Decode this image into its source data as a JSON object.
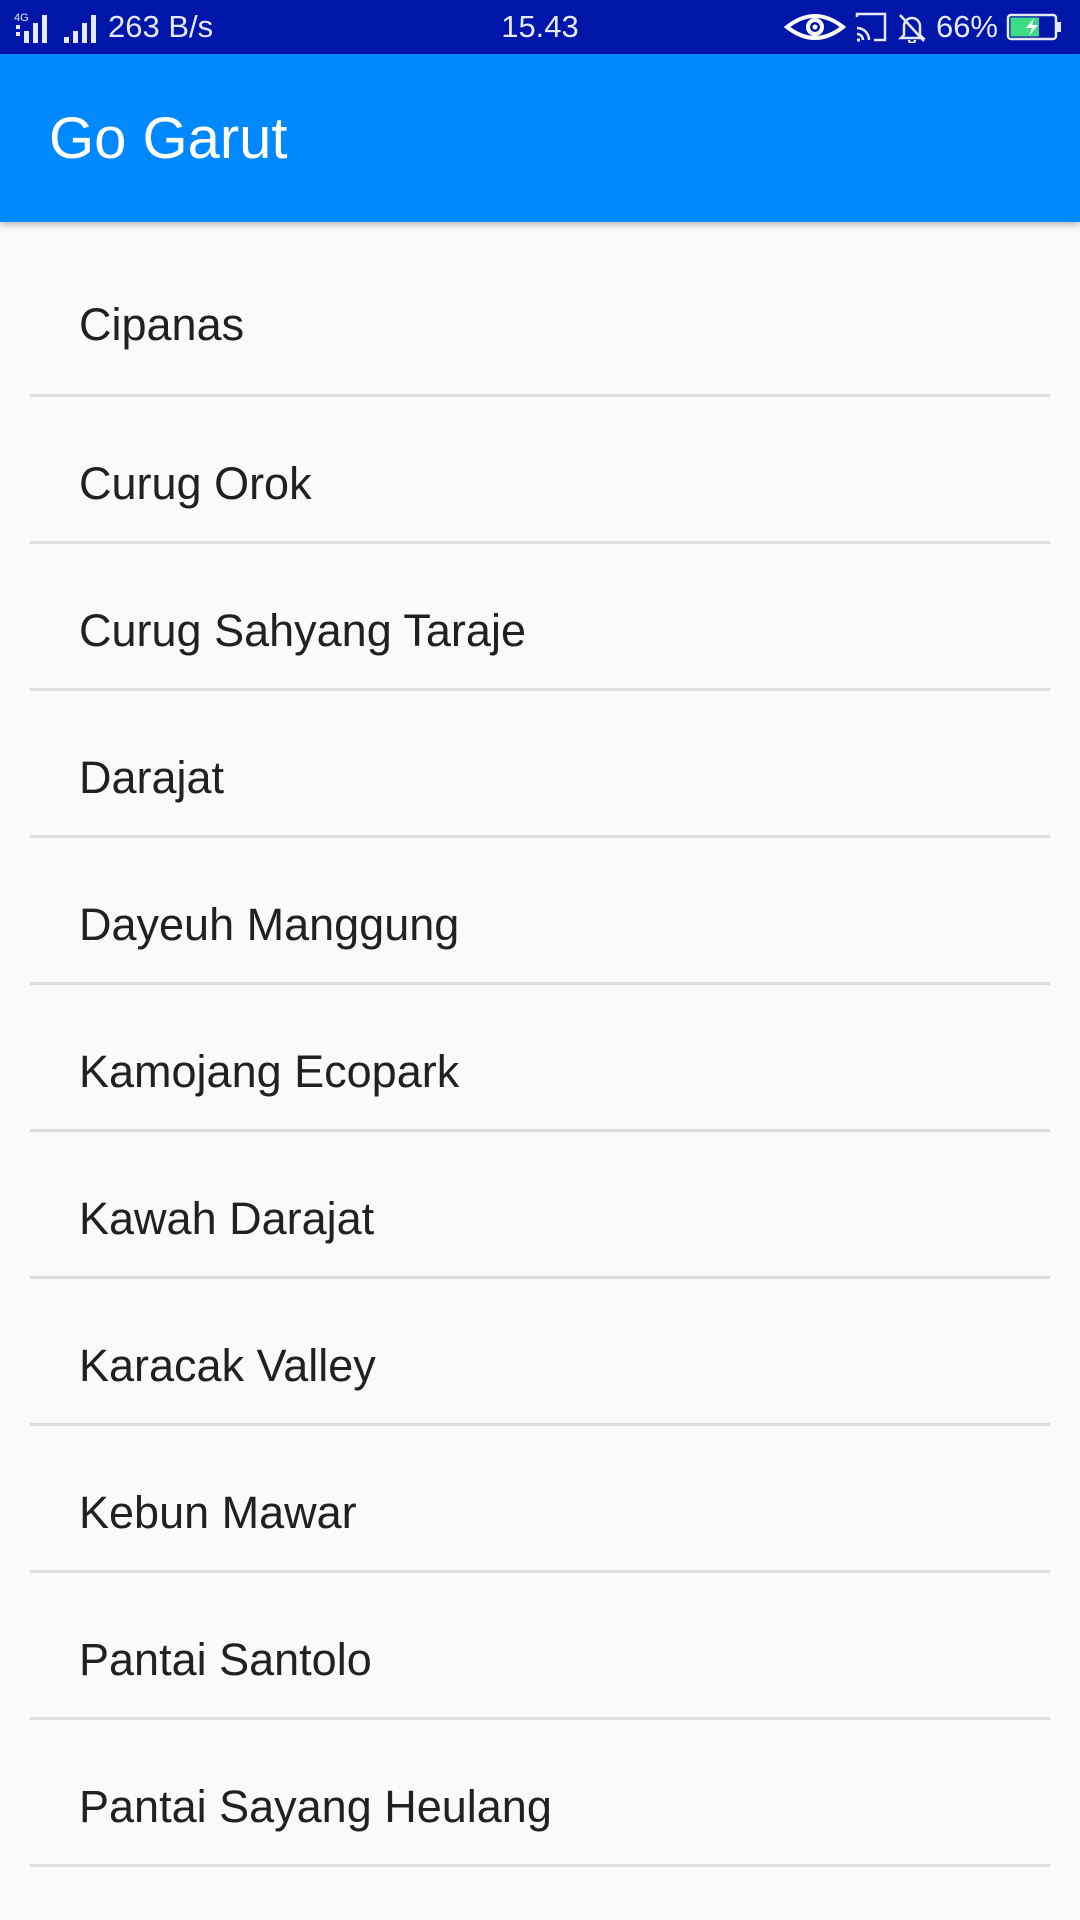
{
  "status_bar": {
    "network_type": "4G",
    "data_speed": "263 B/s",
    "time": "15.43",
    "battery_percent": "66%",
    "battery_level": 0.66,
    "icons": [
      "signal-4g-icon",
      "signal-icon",
      "eye-icon",
      "cast-icon",
      "bell-off-icon",
      "battery-charging-icon"
    ]
  },
  "app_bar": {
    "title": "Go Garut"
  },
  "list": {
    "items": [
      {
        "label": "Cipanas"
      },
      {
        "label": "Curug Orok"
      },
      {
        "label": "Curug Sahyang Taraje"
      },
      {
        "label": "Darajat"
      },
      {
        "label": "Dayeuh Manggung"
      },
      {
        "label": "Kamojang Ecopark"
      },
      {
        "label": "Kawah Darajat"
      },
      {
        "label": "Karacak Valley"
      },
      {
        "label": "Kebun Mawar"
      },
      {
        "label": "Pantai Santolo"
      },
      {
        "label": "Pantai Sayang Heulang"
      }
    ]
  },
  "colors": {
    "status_bar": "#0016a8",
    "app_bar": "#0088ff",
    "background": "#fafafa",
    "divider": "#dddddd",
    "text": "#212121",
    "battery_fill": "#3ddc84"
  }
}
